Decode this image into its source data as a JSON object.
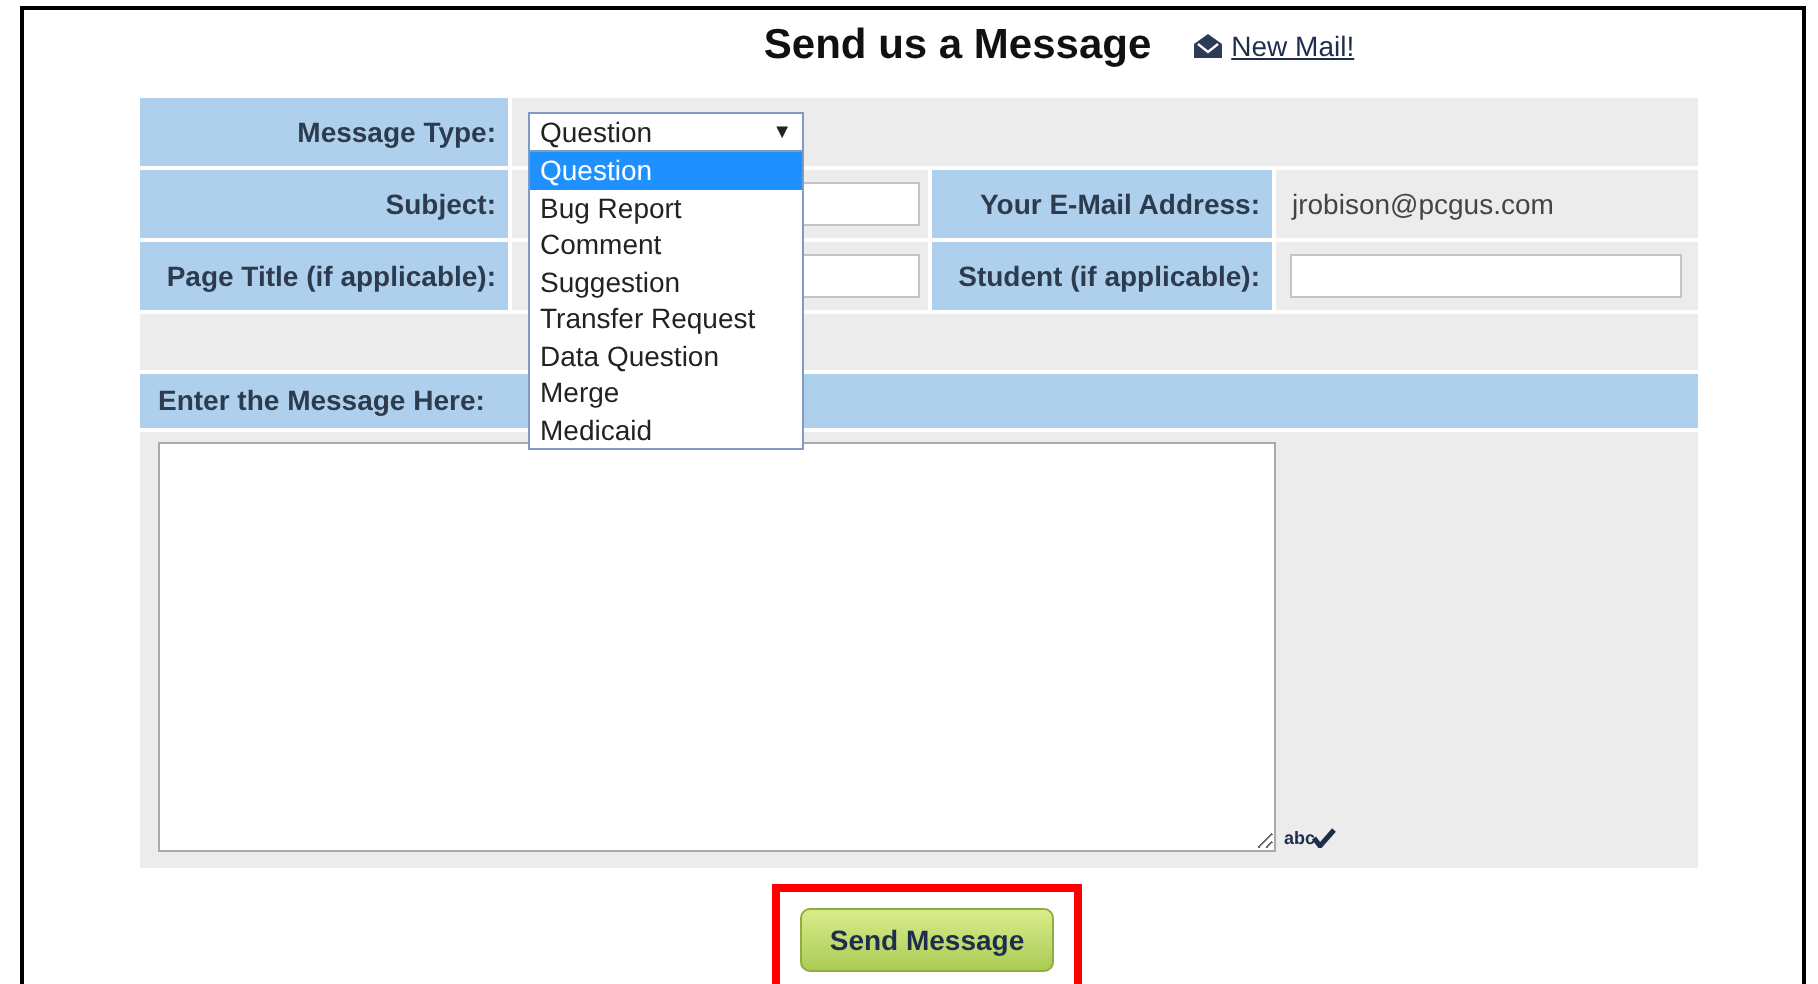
{
  "title": "Send us a Message",
  "new_mail_link": "New Mail!",
  "message_type": {
    "label": "Message Type:",
    "value": "Question",
    "caret": "▼",
    "expanded": true,
    "options": [
      {
        "label": "Question",
        "selected": true
      },
      {
        "label": "Bug Report",
        "selected": false
      },
      {
        "label": "Comment",
        "selected": false
      },
      {
        "label": "Suggestion",
        "selected": false
      },
      {
        "label": "Transfer Request",
        "selected": false
      },
      {
        "label": "Data Question",
        "selected": false
      },
      {
        "label": "Merge",
        "selected": false
      },
      {
        "label": "Medicaid",
        "selected": false
      }
    ]
  },
  "subject": {
    "label": "Subject:"
  },
  "email": {
    "label": "Your E-Mail Address:",
    "value": "jrobison@pcgus.com"
  },
  "page_title": {
    "label": "Page Title (if applicable):"
  },
  "student": {
    "label": "Student (if applicable):"
  },
  "message": {
    "label": "Enter the Message Here:"
  },
  "spellcheck": "abc",
  "send_button": "Send Message"
}
